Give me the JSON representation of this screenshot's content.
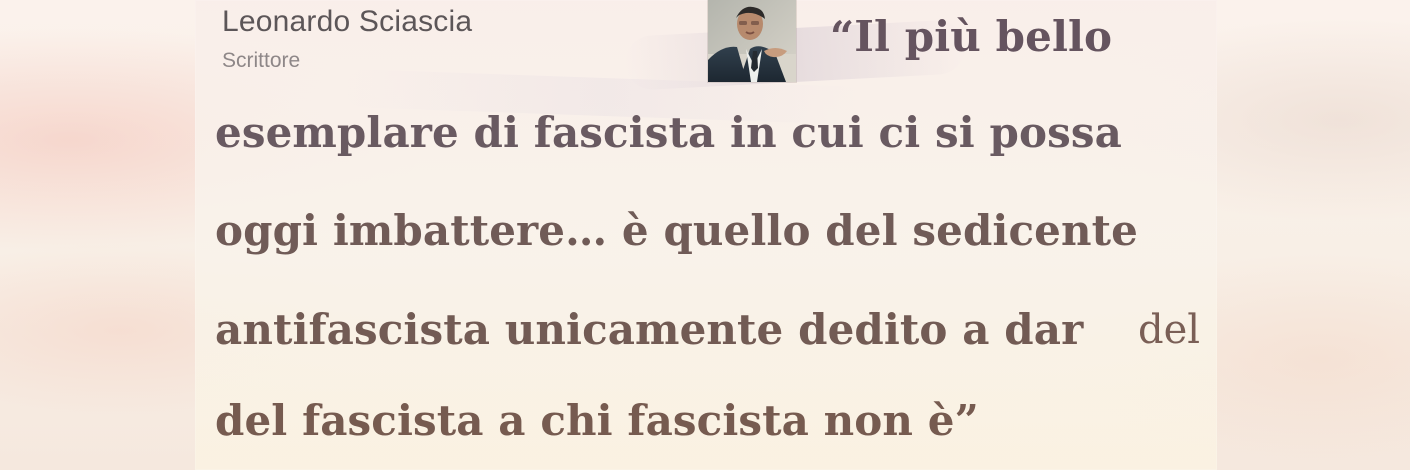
{
  "author": {
    "name": "Leonardo Sciascia",
    "role": "Scrittore",
    "portrait_icon": "portrait-photo-icon"
  },
  "quote": {
    "lines": [
      "“Il più bello",
      "esemplare di fascista in cui ci si possa",
      "oggi imbattere… è quello del sedicente",
      "antifascista unicamente dedito a dar",
      "del fascista a chi fascista non è”"
    ],
    "tail_fragment": "del"
  },
  "colors": {
    "quote_text": "#6f5a58",
    "author_name": "#5c5658",
    "author_role": "#8e8788",
    "background": "#f7eee6",
    "panel": "#f8efe8"
  }
}
